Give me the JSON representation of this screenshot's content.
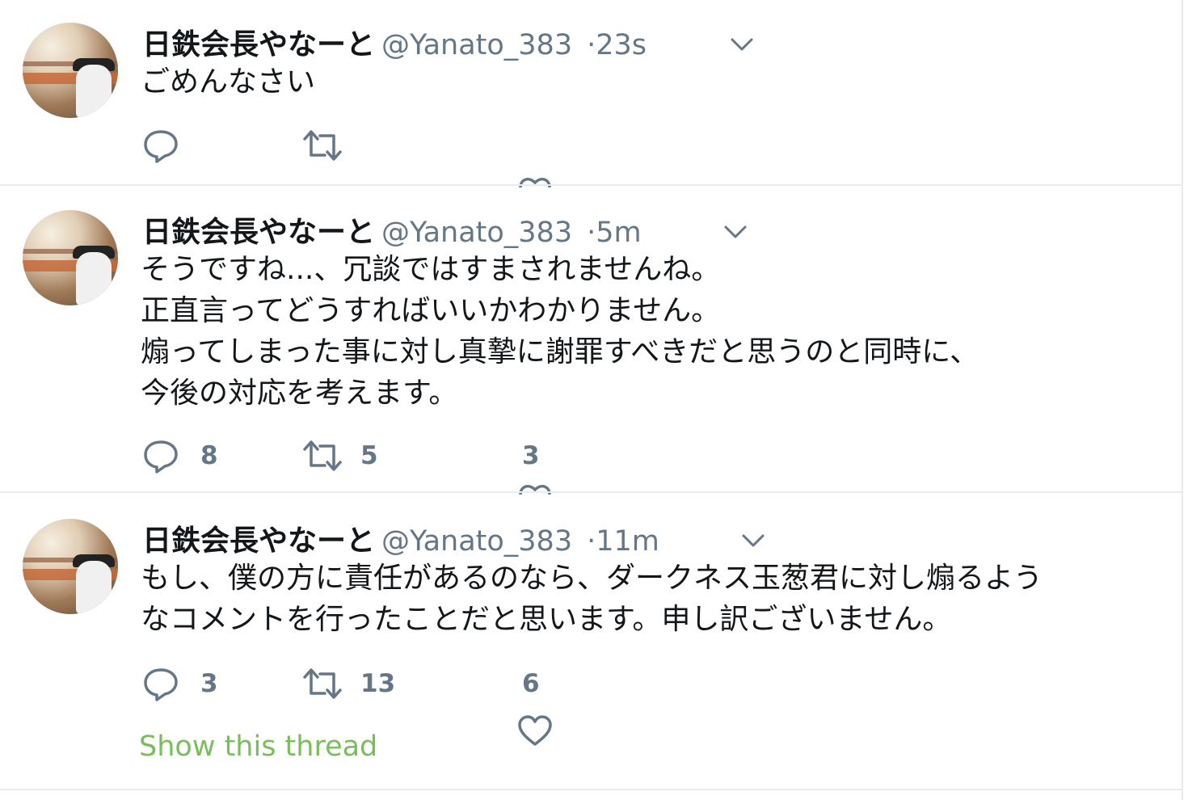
{
  "tweets": [
    {
      "name": "日鉄会長やなーと",
      "handle": "@Yanato_383",
      "separator": "·",
      "time": "23s",
      "lines": [
        "ごめんなさい"
      ],
      "replies": "",
      "retweets": "",
      "likes": ""
    },
    {
      "name": "日鉄会長やなーと",
      "handle": "@Yanato_383",
      "separator": "·",
      "time": "5m",
      "lines": [
        "そうですね...、冗談ではすまされませんね。",
        "正直言ってどうすればいいかわかりません。",
        "煽ってしまった事に対し真摯に謝罪すべきだと思うのと同時に、",
        "今後の対応を考えます。"
      ],
      "replies": "8",
      "retweets": "5",
      "likes": "3"
    },
    {
      "name": "日鉄会長やなーと",
      "handle": "@Yanato_383",
      "separator": "·",
      "time": "11m",
      "lines": [
        "もし、僕の方に責任があるのなら、ダークネス玉葱君に対し煽るよう",
        "なコメントを行ったことだと思います。申し訳ございません。"
      ],
      "replies": "3",
      "retweets": "13",
      "likes": "6",
      "show_thread": "Show this thread"
    }
  ],
  "colors": {
    "text": "#14171a",
    "secondary": "#657786",
    "divider": "#e6ecf0",
    "thread_link": "#79bd5c"
  },
  "icons": {
    "reply": "reply-icon",
    "retweet": "retweet-icon",
    "like": "heart-icon",
    "more": "chevron-down-icon",
    "avatar": "avatar"
  }
}
